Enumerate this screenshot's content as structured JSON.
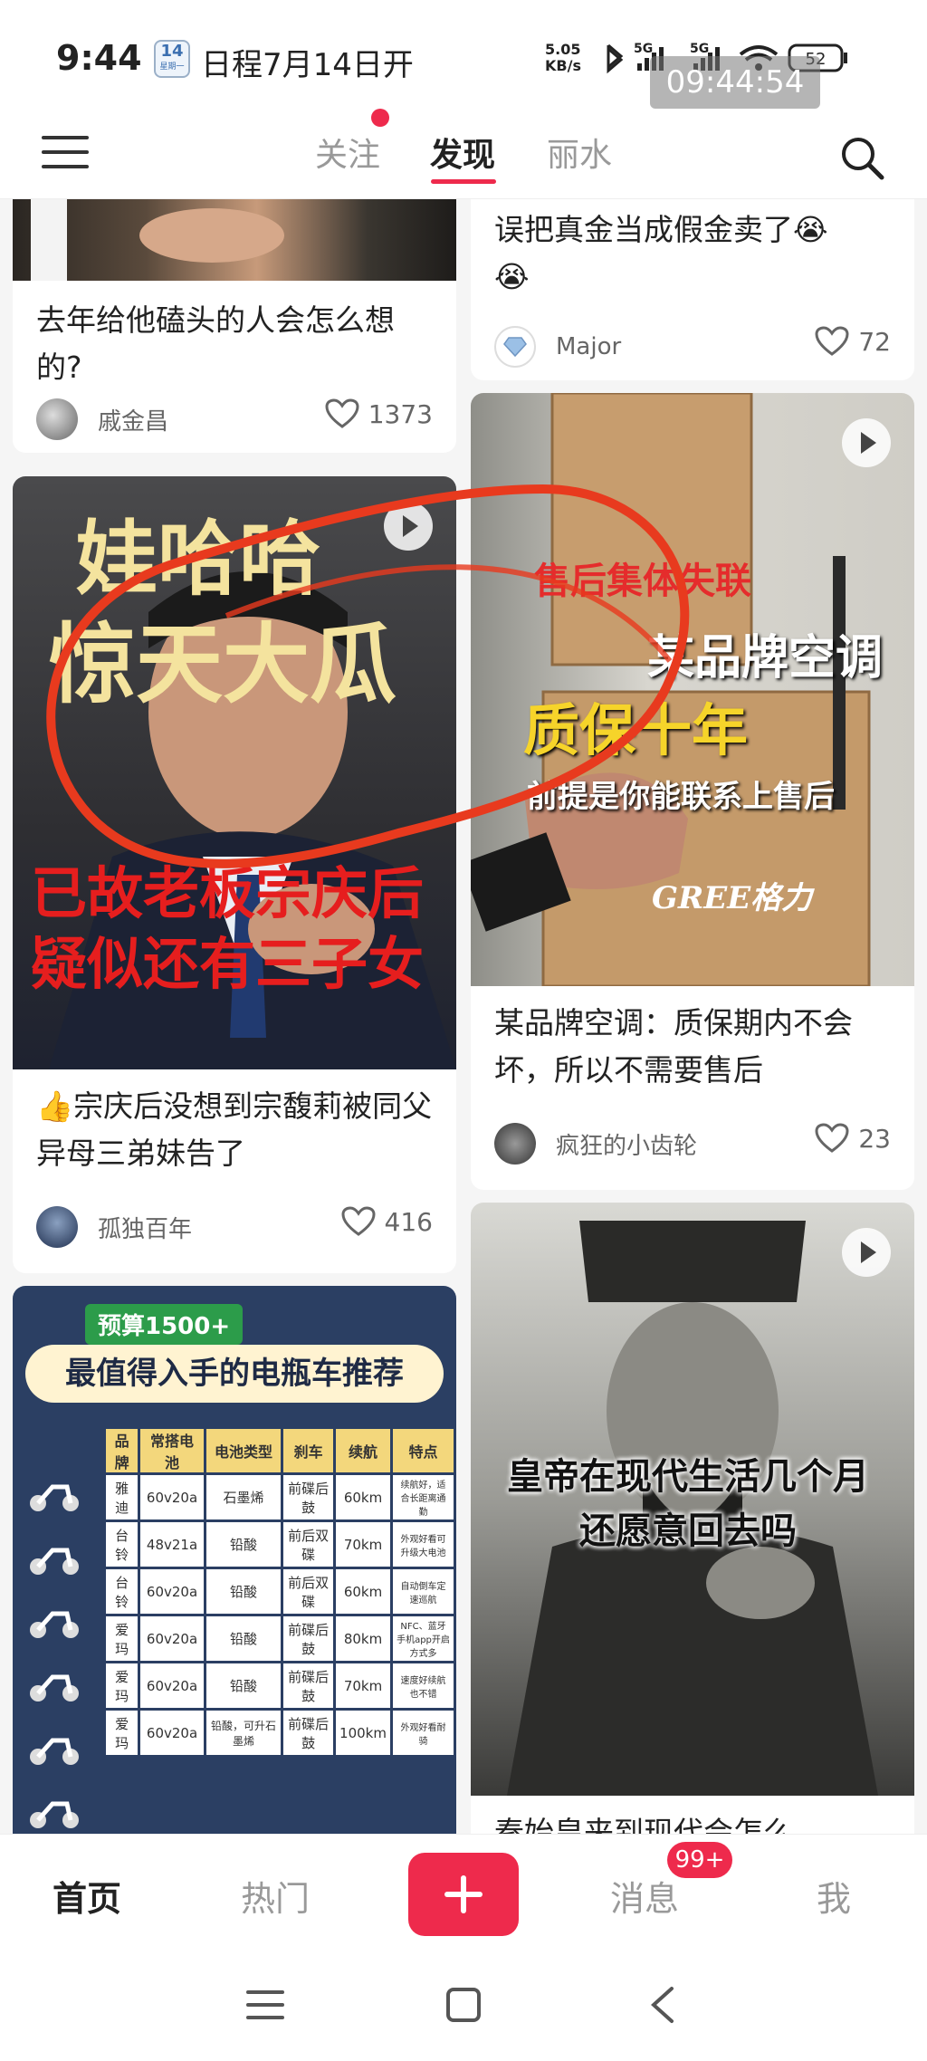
{
  "status_bar": {
    "time": "9:44",
    "calendar_day": "14",
    "calendar_sub": "星期一",
    "event": "日程7月14日开",
    "net_speed_value": "5.05",
    "net_speed_unit": "KB/s",
    "battery": "52",
    "overlay_clock": "09:44:54"
  },
  "top_nav": {
    "tabs": [
      {
        "label": "关注"
      },
      {
        "label": "发现"
      },
      {
        "label": "丽水"
      }
    ],
    "active_tab": "发现"
  },
  "feed": {
    "cards": [
      {
        "title": "去年给他磕头的人会怎么想的?",
        "author": "戚金昌",
        "likes": "1373"
      },
      {
        "title": "误把真金当成假金卖了😭",
        "title_line2": "😭",
        "author": "Major",
        "likes": "72"
      },
      {
        "overlay_top": "娃哈哈",
        "overlay_mid": "惊天大瓜",
        "overlay_bottom1": "已故老板宗庆后",
        "overlay_bottom2": "疑似还有三子女",
        "title": "👍宗庆后没想到宗馥莉被同父异母三弟妹告了",
        "author": "孤独百年",
        "likes": "416"
      },
      {
        "overlay_1": "售后集体失联",
        "overlay_2": "某品牌空调",
        "overlay_3": "质保十年",
        "overlay_4": "前提是你能联系上售后",
        "box_brand": "GREE格力",
        "title": "某品牌空调：质保期内不会坏，所以不需要售后",
        "author": "疯狂的小齿轮",
        "likes": "23"
      },
      {
        "banner_budget": "预算1500+",
        "banner_title": "最值得入手的电瓶车推荐",
        "table_headers": [
          "品牌",
          "常搭电池",
          "电池类型",
          "刹车",
          "续航",
          "特点"
        ],
        "table_rows": [
          [
            "雅迪",
            "60v20a",
            "石墨烯",
            "前碟后鼓",
            "60km",
            "续航好，适合长距离通勤"
          ],
          [
            "台铃",
            "48v21a",
            "铅酸",
            "前后双碟",
            "70km",
            "外观好看可升级大电池"
          ],
          [
            "台铃",
            "60v20a",
            "铅酸",
            "前后双碟",
            "60km",
            "自动倒车定速巡航"
          ],
          [
            "爱玛",
            "60v20a",
            "铅酸",
            "前碟后鼓",
            "80km",
            "NFC、蓝牙手机app开启方式多"
          ],
          [
            "爱玛",
            "60v20a",
            "铅酸",
            "前碟后鼓",
            "70km",
            "速度好续航也不错"
          ],
          [
            "爱玛",
            "60v20a",
            "铅酸，可升石墨烯",
            "前碟后鼓",
            "100km",
            "外观好看耐骑"
          ]
        ]
      },
      {
        "overlay_1": "皇帝在现代生活几个月",
        "overlay_2": "还愿意回去吗",
        "title": "秦始皇来到现代会怎么"
      }
    ]
  },
  "bottom_nav": {
    "home": "首页",
    "hot": "热门",
    "messages": "消息",
    "messages_badge": "99+",
    "me": "我"
  },
  "colors": {
    "accent": "#ee2a4c",
    "annotation_red": "#e83a1e",
    "bike_bg": "#2b3f63"
  }
}
